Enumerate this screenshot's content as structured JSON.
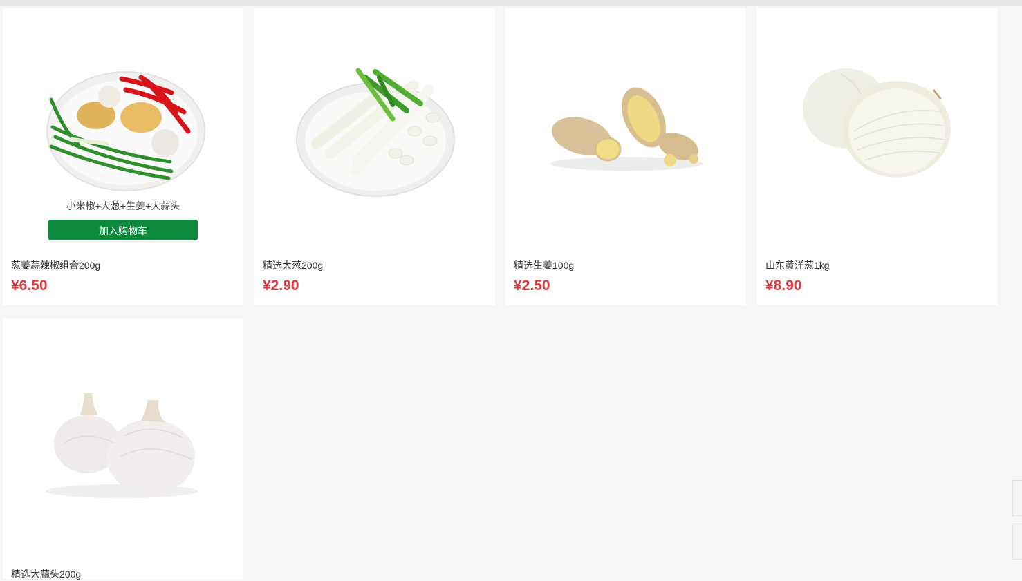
{
  "products": [
    {
      "name": "葱姜蒜辣椒组合200g",
      "price": "¥6.50",
      "image_icon": "scallion-ginger-garlic-chili-plate",
      "hover_subtitle": "小米椒+大葱+生姜+大蒜头",
      "cart_label": "加入购物车"
    },
    {
      "name": "精选大葱200g",
      "price": "¥2.90",
      "image_icon": "scallion-plate"
    },
    {
      "name": "精选生姜100g",
      "price": "¥2.50",
      "image_icon": "ginger-root"
    },
    {
      "name": "山东黄洋葱1kg",
      "price": "¥8.90",
      "image_icon": "onion-halves"
    },
    {
      "name": "精选大蒜头200g",
      "image_icon": "garlic-bulbs"
    }
  ],
  "colors": {
    "accent_green": "#0e8a3e",
    "price_red": "#e4393c",
    "page_bg": "#f5f7f6"
  }
}
